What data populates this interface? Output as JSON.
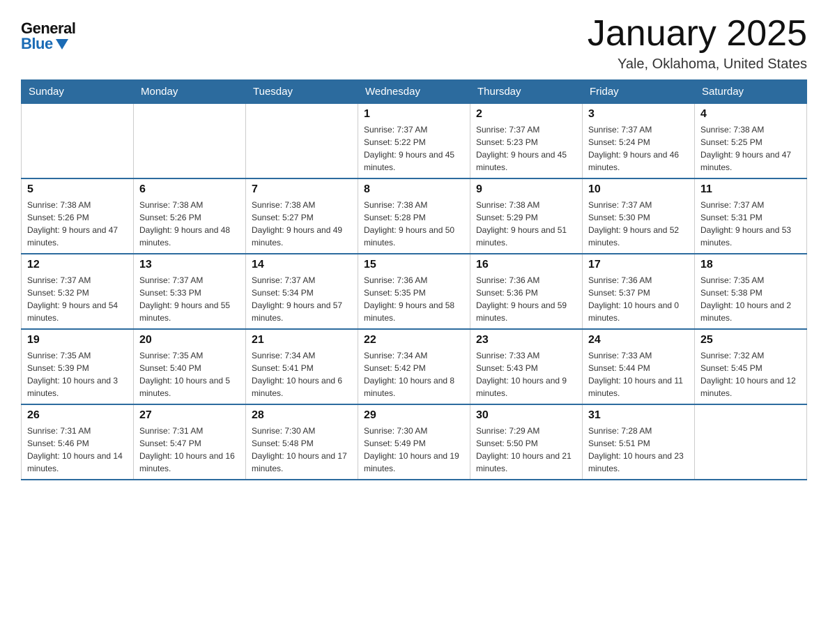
{
  "header": {
    "logo_general": "General",
    "logo_blue": "Blue",
    "month_title": "January 2025",
    "location": "Yale, Oklahoma, United States"
  },
  "weekdays": [
    "Sunday",
    "Monday",
    "Tuesday",
    "Wednesday",
    "Thursday",
    "Friday",
    "Saturday"
  ],
  "weeks": [
    [
      {
        "day": "",
        "sunrise": "",
        "sunset": "",
        "daylight": ""
      },
      {
        "day": "",
        "sunrise": "",
        "sunset": "",
        "daylight": ""
      },
      {
        "day": "",
        "sunrise": "",
        "sunset": "",
        "daylight": ""
      },
      {
        "day": "1",
        "sunrise": "Sunrise: 7:37 AM",
        "sunset": "Sunset: 5:22 PM",
        "daylight": "Daylight: 9 hours and 45 minutes."
      },
      {
        "day": "2",
        "sunrise": "Sunrise: 7:37 AM",
        "sunset": "Sunset: 5:23 PM",
        "daylight": "Daylight: 9 hours and 45 minutes."
      },
      {
        "day": "3",
        "sunrise": "Sunrise: 7:37 AM",
        "sunset": "Sunset: 5:24 PM",
        "daylight": "Daylight: 9 hours and 46 minutes."
      },
      {
        "day": "4",
        "sunrise": "Sunrise: 7:38 AM",
        "sunset": "Sunset: 5:25 PM",
        "daylight": "Daylight: 9 hours and 47 minutes."
      }
    ],
    [
      {
        "day": "5",
        "sunrise": "Sunrise: 7:38 AM",
        "sunset": "Sunset: 5:26 PM",
        "daylight": "Daylight: 9 hours and 47 minutes."
      },
      {
        "day": "6",
        "sunrise": "Sunrise: 7:38 AM",
        "sunset": "Sunset: 5:26 PM",
        "daylight": "Daylight: 9 hours and 48 minutes."
      },
      {
        "day": "7",
        "sunrise": "Sunrise: 7:38 AM",
        "sunset": "Sunset: 5:27 PM",
        "daylight": "Daylight: 9 hours and 49 minutes."
      },
      {
        "day": "8",
        "sunrise": "Sunrise: 7:38 AM",
        "sunset": "Sunset: 5:28 PM",
        "daylight": "Daylight: 9 hours and 50 minutes."
      },
      {
        "day": "9",
        "sunrise": "Sunrise: 7:38 AM",
        "sunset": "Sunset: 5:29 PM",
        "daylight": "Daylight: 9 hours and 51 minutes."
      },
      {
        "day": "10",
        "sunrise": "Sunrise: 7:37 AM",
        "sunset": "Sunset: 5:30 PM",
        "daylight": "Daylight: 9 hours and 52 minutes."
      },
      {
        "day": "11",
        "sunrise": "Sunrise: 7:37 AM",
        "sunset": "Sunset: 5:31 PM",
        "daylight": "Daylight: 9 hours and 53 minutes."
      }
    ],
    [
      {
        "day": "12",
        "sunrise": "Sunrise: 7:37 AM",
        "sunset": "Sunset: 5:32 PM",
        "daylight": "Daylight: 9 hours and 54 minutes."
      },
      {
        "day": "13",
        "sunrise": "Sunrise: 7:37 AM",
        "sunset": "Sunset: 5:33 PM",
        "daylight": "Daylight: 9 hours and 55 minutes."
      },
      {
        "day": "14",
        "sunrise": "Sunrise: 7:37 AM",
        "sunset": "Sunset: 5:34 PM",
        "daylight": "Daylight: 9 hours and 57 minutes."
      },
      {
        "day": "15",
        "sunrise": "Sunrise: 7:36 AM",
        "sunset": "Sunset: 5:35 PM",
        "daylight": "Daylight: 9 hours and 58 minutes."
      },
      {
        "day": "16",
        "sunrise": "Sunrise: 7:36 AM",
        "sunset": "Sunset: 5:36 PM",
        "daylight": "Daylight: 9 hours and 59 minutes."
      },
      {
        "day": "17",
        "sunrise": "Sunrise: 7:36 AM",
        "sunset": "Sunset: 5:37 PM",
        "daylight": "Daylight: 10 hours and 0 minutes."
      },
      {
        "day": "18",
        "sunrise": "Sunrise: 7:35 AM",
        "sunset": "Sunset: 5:38 PM",
        "daylight": "Daylight: 10 hours and 2 minutes."
      }
    ],
    [
      {
        "day": "19",
        "sunrise": "Sunrise: 7:35 AM",
        "sunset": "Sunset: 5:39 PM",
        "daylight": "Daylight: 10 hours and 3 minutes."
      },
      {
        "day": "20",
        "sunrise": "Sunrise: 7:35 AM",
        "sunset": "Sunset: 5:40 PM",
        "daylight": "Daylight: 10 hours and 5 minutes."
      },
      {
        "day": "21",
        "sunrise": "Sunrise: 7:34 AM",
        "sunset": "Sunset: 5:41 PM",
        "daylight": "Daylight: 10 hours and 6 minutes."
      },
      {
        "day": "22",
        "sunrise": "Sunrise: 7:34 AM",
        "sunset": "Sunset: 5:42 PM",
        "daylight": "Daylight: 10 hours and 8 minutes."
      },
      {
        "day": "23",
        "sunrise": "Sunrise: 7:33 AM",
        "sunset": "Sunset: 5:43 PM",
        "daylight": "Daylight: 10 hours and 9 minutes."
      },
      {
        "day": "24",
        "sunrise": "Sunrise: 7:33 AM",
        "sunset": "Sunset: 5:44 PM",
        "daylight": "Daylight: 10 hours and 11 minutes."
      },
      {
        "day": "25",
        "sunrise": "Sunrise: 7:32 AM",
        "sunset": "Sunset: 5:45 PM",
        "daylight": "Daylight: 10 hours and 12 minutes."
      }
    ],
    [
      {
        "day": "26",
        "sunrise": "Sunrise: 7:31 AM",
        "sunset": "Sunset: 5:46 PM",
        "daylight": "Daylight: 10 hours and 14 minutes."
      },
      {
        "day": "27",
        "sunrise": "Sunrise: 7:31 AM",
        "sunset": "Sunset: 5:47 PM",
        "daylight": "Daylight: 10 hours and 16 minutes."
      },
      {
        "day": "28",
        "sunrise": "Sunrise: 7:30 AM",
        "sunset": "Sunset: 5:48 PM",
        "daylight": "Daylight: 10 hours and 17 minutes."
      },
      {
        "day": "29",
        "sunrise": "Sunrise: 7:30 AM",
        "sunset": "Sunset: 5:49 PM",
        "daylight": "Daylight: 10 hours and 19 minutes."
      },
      {
        "day": "30",
        "sunrise": "Sunrise: 7:29 AM",
        "sunset": "Sunset: 5:50 PM",
        "daylight": "Daylight: 10 hours and 21 minutes."
      },
      {
        "day": "31",
        "sunrise": "Sunrise: 7:28 AM",
        "sunset": "Sunset: 5:51 PM",
        "daylight": "Daylight: 10 hours and 23 minutes."
      },
      {
        "day": "",
        "sunrise": "",
        "sunset": "",
        "daylight": ""
      }
    ]
  ]
}
